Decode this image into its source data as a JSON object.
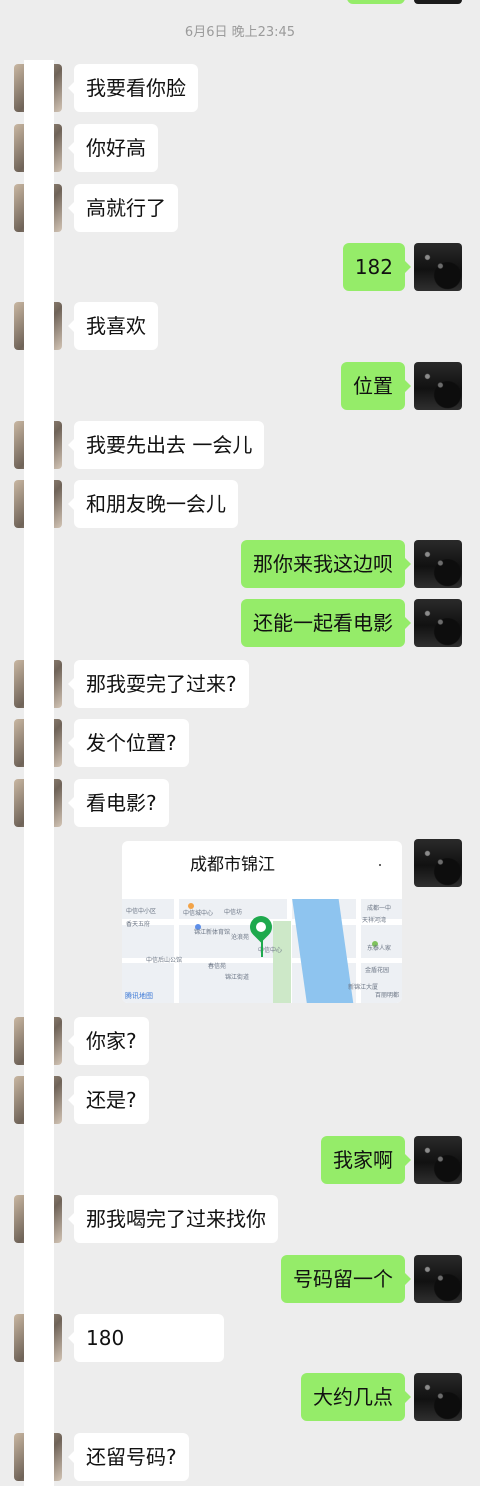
{
  "chat": {
    "timestamp": "6月6日 晚上23:45",
    "messages": [
      {
        "side": "left",
        "text": "我要看你脸"
      },
      {
        "side": "left",
        "text": "你好高"
      },
      {
        "side": "left",
        "text": "高就行了"
      },
      {
        "side": "right",
        "text": "182"
      },
      {
        "side": "left",
        "text": "我喜欢"
      },
      {
        "side": "right",
        "text": "位置"
      },
      {
        "side": "left",
        "text": "我要先出去 一会儿"
      },
      {
        "side": "left",
        "text": "和朋友晚一会儿"
      },
      {
        "side": "right",
        "text": "那你来我这边呗"
      },
      {
        "side": "right",
        "text": "还能一起看电影"
      },
      {
        "side": "left",
        "text": "那我耍完了过来?"
      },
      {
        "side": "left",
        "text": "发个位置?"
      },
      {
        "side": "left",
        "text": "看电影?"
      },
      {
        "side": "left",
        "text": "你家?"
      },
      {
        "side": "left",
        "text": "还是?"
      },
      {
        "side": "right",
        "text": "我家啊"
      },
      {
        "side": "left",
        "text": "那我喝完了过来找你"
      },
      {
        "side": "right",
        "text": "号码留一个"
      },
      {
        "side": "left",
        "text": "180"
      },
      {
        "side": "right",
        "text": "大约几点"
      },
      {
        "side": "left",
        "text": "还留号码?"
      }
    ]
  },
  "location": {
    "title": "成都市锦江",
    "map_labels": [
      "中信中小区",
      "香天五府",
      "中信城中心",
      "中信坊",
      "锦江新体育馆",
      "沧浪苑",
      "中信后山公馆",
      "春信苑",
      "锦江街道",
      "中信中心",
      "成都一中",
      "天祥河湾",
      "东泰人家",
      "金盾花园",
      "新锦江大厦",
      "百丽明都"
    ],
    "brand": "腾讯地图"
  },
  "colors": {
    "background": "#ededed",
    "bubble_left": "#ffffff",
    "bubble_right": "#95ec69",
    "timestamp_text": "#9b9b9b"
  },
  "icons": {
    "left_avatar": "contact-avatar-icon",
    "right_avatar": "user-avatar-icon",
    "location_pin": "location-pin-icon"
  }
}
